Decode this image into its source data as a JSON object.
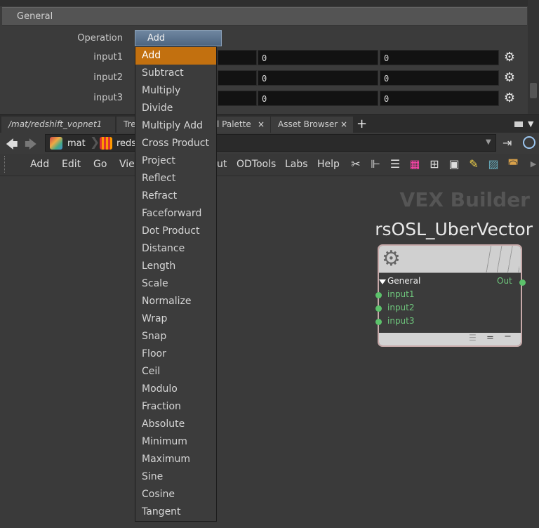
{
  "parameters": {
    "section_title": "General",
    "operation_label": "Operation",
    "operation_value": "Add",
    "rows": [
      {
        "label": "input1",
        "values": [
          "0",
          "0"
        ]
      },
      {
        "label": "input2",
        "values": [
          "0",
          "0"
        ]
      },
      {
        "label": "input3",
        "values": [
          "0",
          "0"
        ]
      }
    ]
  },
  "tabs": [
    "/mat/redshift_vopnet1",
    "Tre",
    "l Palette",
    "Asset Browser"
  ],
  "tab_close": "×",
  "tab_add": "+",
  "path": {
    "crumbs": [
      "mat",
      "reds"
    ]
  },
  "menu": [
    "Add",
    "Edit",
    "Go",
    "Vie",
    "ut",
    "ODTools",
    "Labs",
    "Help"
  ],
  "network": {
    "context_title": "VEX Builder",
    "node_name": "rsOSL_UberVector",
    "node_section": "General",
    "output_label": "Out",
    "inputs": [
      "input1",
      "input2",
      "input3"
    ]
  },
  "dropdown_options": [
    "Add",
    "Subtract",
    "Multiply",
    "Divide",
    "Multiply Add",
    "Cross Product",
    "Project",
    "Reflect",
    "Refract",
    "Faceforward",
    "Dot Product",
    "Distance",
    "Length",
    "Scale",
    "Normalize",
    "Wrap",
    "Snap",
    "Floor",
    "Ceil",
    "Modulo",
    "Fraction",
    "Absolute",
    "Minimum",
    "Maximum",
    "Sine",
    "Cosine",
    "Tangent"
  ],
  "selected_option": "Add",
  "colors": {
    "selection": "#c2700f",
    "port": "#5cc26b",
    "node_border": "#c7a9a9"
  }
}
